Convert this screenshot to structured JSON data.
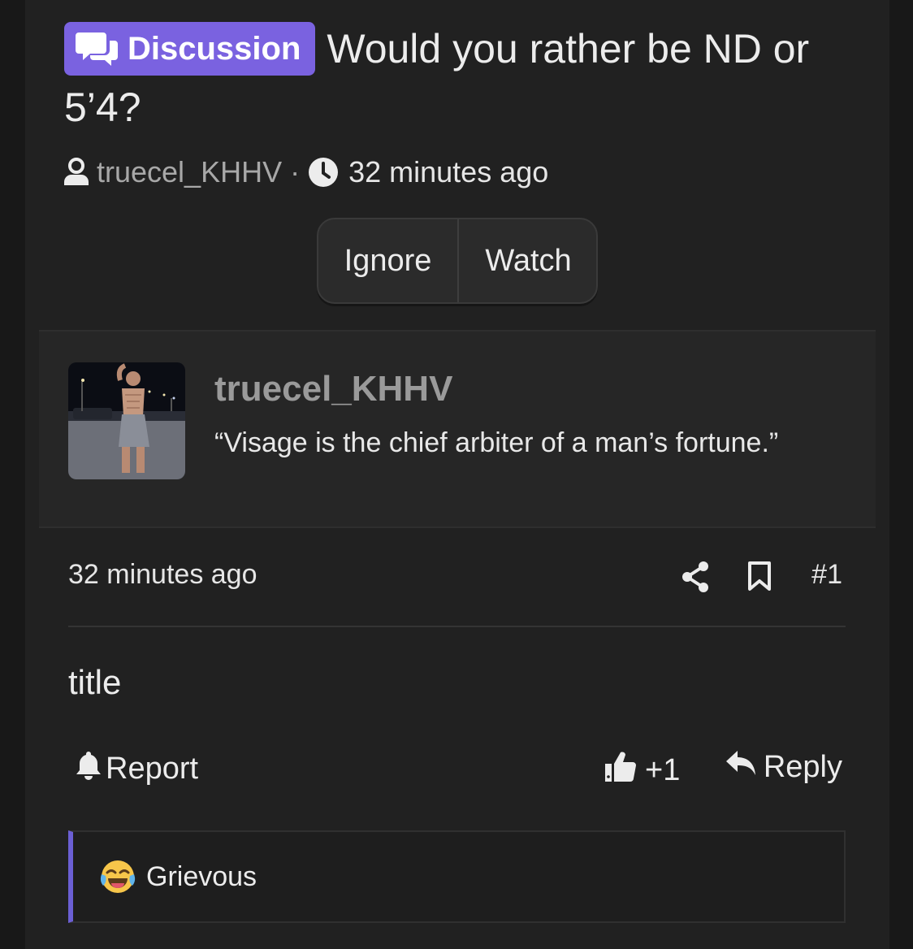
{
  "thread": {
    "prefix": "Discussion",
    "title": "Would you rather be ND or 5’4?",
    "author": "truecel_KHHV",
    "separator": "·",
    "time": "32 minutes ago"
  },
  "actions": {
    "ignore": "Ignore",
    "watch": "Watch"
  },
  "post": {
    "username": "truecel_KHHV",
    "signature": "“Visage is the chief arbiter of a man’s fortune.”",
    "time": "32 minutes ago",
    "number": "#1",
    "body": "title",
    "report": "Report",
    "like_count": "+1",
    "reply": "Reply",
    "reaction": "Grievous"
  },
  "colors": {
    "accent": "#7a62e0",
    "reaction_border": "#6b5fd4",
    "background": "#212121"
  },
  "icons": [
    "comments-icon",
    "user-icon",
    "clock-icon",
    "share-icon",
    "bookmark-icon",
    "bell-icon",
    "thumbs-up-icon",
    "reply-icon",
    "laughing-crying-emoji-icon"
  ]
}
